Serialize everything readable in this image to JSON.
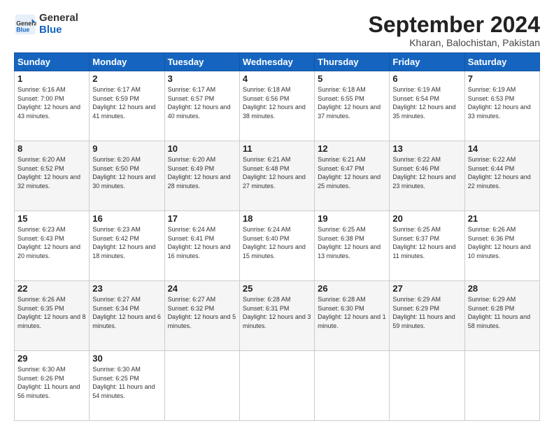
{
  "header": {
    "logo_general": "General",
    "logo_blue": "Blue",
    "month_title": "September 2024",
    "location": "Kharan, Balochistan, Pakistan"
  },
  "weekdays": [
    "Sunday",
    "Monday",
    "Tuesday",
    "Wednesday",
    "Thursday",
    "Friday",
    "Saturday"
  ],
  "weeks": [
    [
      {
        "day": "1",
        "sunrise": "Sunrise: 6:16 AM",
        "sunset": "Sunset: 7:00 PM",
        "daylight": "Daylight: 12 hours and 43 minutes."
      },
      {
        "day": "2",
        "sunrise": "Sunrise: 6:17 AM",
        "sunset": "Sunset: 6:59 PM",
        "daylight": "Daylight: 12 hours and 41 minutes."
      },
      {
        "day": "3",
        "sunrise": "Sunrise: 6:17 AM",
        "sunset": "Sunset: 6:57 PM",
        "daylight": "Daylight: 12 hours and 40 minutes."
      },
      {
        "day": "4",
        "sunrise": "Sunrise: 6:18 AM",
        "sunset": "Sunset: 6:56 PM",
        "daylight": "Daylight: 12 hours and 38 minutes."
      },
      {
        "day": "5",
        "sunrise": "Sunrise: 6:18 AM",
        "sunset": "Sunset: 6:55 PM",
        "daylight": "Daylight: 12 hours and 37 minutes."
      },
      {
        "day": "6",
        "sunrise": "Sunrise: 6:19 AM",
        "sunset": "Sunset: 6:54 PM",
        "daylight": "Daylight: 12 hours and 35 minutes."
      },
      {
        "day": "7",
        "sunrise": "Sunrise: 6:19 AM",
        "sunset": "Sunset: 6:53 PM",
        "daylight": "Daylight: 12 hours and 33 minutes."
      }
    ],
    [
      {
        "day": "8",
        "sunrise": "Sunrise: 6:20 AM",
        "sunset": "Sunset: 6:52 PM",
        "daylight": "Daylight: 12 hours and 32 minutes."
      },
      {
        "day": "9",
        "sunrise": "Sunrise: 6:20 AM",
        "sunset": "Sunset: 6:50 PM",
        "daylight": "Daylight: 12 hours and 30 minutes."
      },
      {
        "day": "10",
        "sunrise": "Sunrise: 6:20 AM",
        "sunset": "Sunset: 6:49 PM",
        "daylight": "Daylight: 12 hours and 28 minutes."
      },
      {
        "day": "11",
        "sunrise": "Sunrise: 6:21 AM",
        "sunset": "Sunset: 6:48 PM",
        "daylight": "Daylight: 12 hours and 27 minutes."
      },
      {
        "day": "12",
        "sunrise": "Sunrise: 6:21 AM",
        "sunset": "Sunset: 6:47 PM",
        "daylight": "Daylight: 12 hours and 25 minutes."
      },
      {
        "day": "13",
        "sunrise": "Sunrise: 6:22 AM",
        "sunset": "Sunset: 6:46 PM",
        "daylight": "Daylight: 12 hours and 23 minutes."
      },
      {
        "day": "14",
        "sunrise": "Sunrise: 6:22 AM",
        "sunset": "Sunset: 6:44 PM",
        "daylight": "Daylight: 12 hours and 22 minutes."
      }
    ],
    [
      {
        "day": "15",
        "sunrise": "Sunrise: 6:23 AM",
        "sunset": "Sunset: 6:43 PM",
        "daylight": "Daylight: 12 hours and 20 minutes."
      },
      {
        "day": "16",
        "sunrise": "Sunrise: 6:23 AM",
        "sunset": "Sunset: 6:42 PM",
        "daylight": "Daylight: 12 hours and 18 minutes."
      },
      {
        "day": "17",
        "sunrise": "Sunrise: 6:24 AM",
        "sunset": "Sunset: 6:41 PM",
        "daylight": "Daylight: 12 hours and 16 minutes."
      },
      {
        "day": "18",
        "sunrise": "Sunrise: 6:24 AM",
        "sunset": "Sunset: 6:40 PM",
        "daylight": "Daylight: 12 hours and 15 minutes."
      },
      {
        "day": "19",
        "sunrise": "Sunrise: 6:25 AM",
        "sunset": "Sunset: 6:38 PM",
        "daylight": "Daylight: 12 hours and 13 minutes."
      },
      {
        "day": "20",
        "sunrise": "Sunrise: 6:25 AM",
        "sunset": "Sunset: 6:37 PM",
        "daylight": "Daylight: 12 hours and 11 minutes."
      },
      {
        "day": "21",
        "sunrise": "Sunrise: 6:26 AM",
        "sunset": "Sunset: 6:36 PM",
        "daylight": "Daylight: 12 hours and 10 minutes."
      }
    ],
    [
      {
        "day": "22",
        "sunrise": "Sunrise: 6:26 AM",
        "sunset": "Sunset: 6:35 PM",
        "daylight": "Daylight: 12 hours and 8 minutes."
      },
      {
        "day": "23",
        "sunrise": "Sunrise: 6:27 AM",
        "sunset": "Sunset: 6:34 PM",
        "daylight": "Daylight: 12 hours and 6 minutes."
      },
      {
        "day": "24",
        "sunrise": "Sunrise: 6:27 AM",
        "sunset": "Sunset: 6:32 PM",
        "daylight": "Daylight: 12 hours and 5 minutes."
      },
      {
        "day": "25",
        "sunrise": "Sunrise: 6:28 AM",
        "sunset": "Sunset: 6:31 PM",
        "daylight": "Daylight: 12 hours and 3 minutes."
      },
      {
        "day": "26",
        "sunrise": "Sunrise: 6:28 AM",
        "sunset": "Sunset: 6:30 PM",
        "daylight": "Daylight: 12 hours and 1 minute."
      },
      {
        "day": "27",
        "sunrise": "Sunrise: 6:29 AM",
        "sunset": "Sunset: 6:29 PM",
        "daylight": "Daylight: 11 hours and 59 minutes."
      },
      {
        "day": "28",
        "sunrise": "Sunrise: 6:29 AM",
        "sunset": "Sunset: 6:28 PM",
        "daylight": "Daylight: 11 hours and 58 minutes."
      }
    ],
    [
      {
        "day": "29",
        "sunrise": "Sunrise: 6:30 AM",
        "sunset": "Sunset: 6:26 PM",
        "daylight": "Daylight: 11 hours and 56 minutes."
      },
      {
        "day": "30",
        "sunrise": "Sunrise: 6:30 AM",
        "sunset": "Sunset: 6:25 PM",
        "daylight": "Daylight: 11 hours and 54 minutes."
      },
      null,
      null,
      null,
      null,
      null
    ]
  ]
}
